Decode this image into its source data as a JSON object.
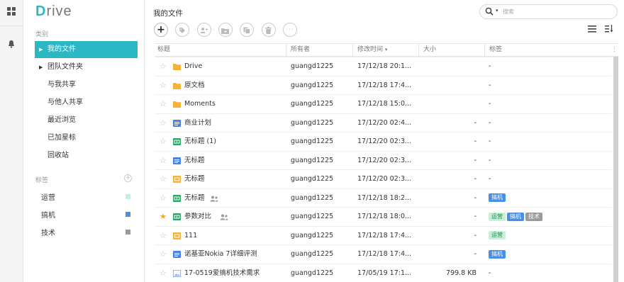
{
  "app": {
    "logo_first": "D",
    "logo_rest": "rive"
  },
  "colors": {
    "accent": "#2bb8c4",
    "tag_blue": "#4a90e2",
    "tag_gray": "#9b9b9b",
    "tag_green": "#c8f0d8",
    "star": "#f5a623"
  },
  "sidebar": {
    "category_title": "类别",
    "nav": [
      {
        "label": "我的文件",
        "active": true,
        "caret": true
      },
      {
        "label": "团队文件夹",
        "caret": true
      },
      {
        "label": "与我共享"
      },
      {
        "label": "与他人共享"
      },
      {
        "label": "最近浏览"
      },
      {
        "label": "已加星标"
      },
      {
        "label": "回收站"
      }
    ],
    "tags_title": "标签",
    "tags": [
      {
        "label": "运营",
        "color": "#c8f0d8"
      },
      {
        "label": "搞机",
        "color": "#4a90e2"
      },
      {
        "label": "技术",
        "color": "#9b9b9b"
      }
    ]
  },
  "main": {
    "title": "我的文件",
    "search_placeholder": "搜索",
    "toolbar": [
      "new",
      "tag",
      "share",
      "move",
      "copy",
      "delete",
      "more"
    ],
    "columns": {
      "name": "标题",
      "owner": "所有者",
      "modified": "修改时间",
      "size": "大小",
      "tags": "标签"
    },
    "rows": [
      {
        "name": "Drive",
        "type": "folder",
        "owner": "guangd1225",
        "modified": "17/12/18 20:1...",
        "size": "",
        "tags": [],
        "tag_text": "-",
        "starred": false
      },
      {
        "name": "原文档",
        "type": "folder",
        "owner": "guangd1225",
        "modified": "17/12/18 17:4...",
        "size": "",
        "tags": [],
        "tag_text": "-",
        "starred": false
      },
      {
        "name": "Moments",
        "type": "folder",
        "owner": "guangd1225",
        "modified": "17/12/18 15:0...",
        "size": "",
        "tags": [],
        "tag_text": "-",
        "starred": false
      },
      {
        "name": "商业计划",
        "type": "doc",
        "owner": "guangd1225",
        "modified": "17/12/20 02:4...",
        "size": "-",
        "tags": [],
        "tag_text": "-",
        "starred": false
      },
      {
        "name": "无标题 (1)",
        "type": "sheet",
        "owner": "guangd1225",
        "modified": "17/12/20 02:3...",
        "size": "-",
        "tags": [],
        "tag_text": "-",
        "starred": false
      },
      {
        "name": "无标题",
        "type": "doc",
        "owner": "guangd1225",
        "modified": "17/12/20 02:3...",
        "size": "-",
        "tags": [],
        "tag_text": "-",
        "starred": false
      },
      {
        "name": "无标题",
        "type": "slide",
        "owner": "guangd1225",
        "modified": "17/12/20 02:3...",
        "size": "-",
        "tags": [],
        "tag_text": "-",
        "starred": false
      },
      {
        "name": "无标题",
        "type": "sheet",
        "shared": true,
        "owner": "guangd1225",
        "modified": "17/12/18 18:2...",
        "size": "-",
        "tags": [
          {
            "label": "搞机",
            "kind": "blue"
          }
        ],
        "tag_text": "",
        "starred": false
      },
      {
        "name": "参数对比",
        "type": "sheet",
        "shared": true,
        "owner": "guangd1225",
        "modified": "17/12/18 18:0...",
        "size": "-",
        "tags": [
          {
            "label": "运营",
            "kind": "green"
          },
          {
            "label": "搞机",
            "kind": "blue"
          },
          {
            "label": "技术",
            "kind": "gray"
          }
        ],
        "tag_text": "",
        "starred": true
      },
      {
        "name": "111",
        "type": "slide",
        "owner": "guangd1225",
        "modified": "17/12/18 17:4...",
        "size": "-",
        "tags": [
          {
            "label": "运营",
            "kind": "green"
          }
        ],
        "tag_text": "",
        "starred": false
      },
      {
        "name": "诺基亚Nokia 7详细评测",
        "type": "doc",
        "owner": "guangd1225",
        "modified": "17/12/18 17:4...",
        "size": "-",
        "tags": [
          {
            "label": "搞机",
            "kind": "blue"
          }
        ],
        "tag_text": "",
        "starred": false
      },
      {
        "name": "17-0519爱搞机技术需求",
        "type": "image",
        "owner": "guangd1225",
        "modified": "17/05/19 17:1...",
        "size": "799.8 KB",
        "tags": [],
        "tag_text": "-",
        "starred": false
      }
    ]
  }
}
